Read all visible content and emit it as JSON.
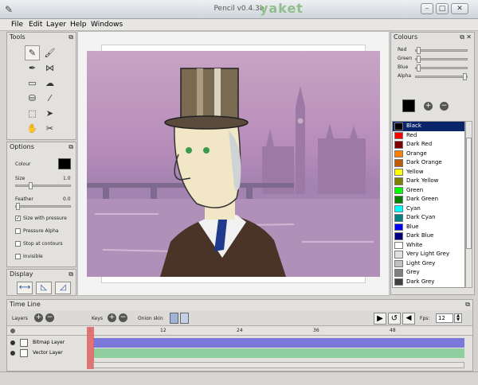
{
  "window": {
    "title": "Pencil v0.4.3b",
    "brand": "yaket",
    "controls": [
      "–",
      "□",
      "✕"
    ]
  },
  "menu": [
    "File",
    "Edit",
    "Layer",
    "Help",
    "Windows"
  ],
  "tools_panel": {
    "title": "Tools",
    "tools": [
      {
        "name": "pencil-icon",
        "glyph": "✎",
        "active": true
      },
      {
        "name": "brush-icon",
        "glyph": "🖌"
      },
      {
        "name": "pen-icon",
        "glyph": "✒"
      },
      {
        "name": "polyline-icon",
        "glyph": "⋈"
      },
      {
        "name": "eraser-icon",
        "glyph": "▭"
      },
      {
        "name": "smudge-icon",
        "glyph": "☁"
      },
      {
        "name": "bucket-icon",
        "glyph": "⛁"
      },
      {
        "name": "eyedropper-icon",
        "glyph": "⁄"
      },
      {
        "name": "select-icon",
        "glyph": "⬚"
      },
      {
        "name": "move-icon",
        "glyph": "➤"
      },
      {
        "name": "hand-icon",
        "glyph": "✋"
      },
      {
        "name": "clear-icon",
        "glyph": "✂"
      }
    ]
  },
  "options_panel": {
    "title": "Options",
    "colour_label": "Colour",
    "colour_value": "#000000",
    "size_label": "Size",
    "size_value": "1.0",
    "size_fraction": 0.25,
    "feather_label": "Feather",
    "feather_value": "0.0",
    "feather_fraction": 0.0,
    "checks": [
      {
        "label": "Size with pressure",
        "checked": true
      },
      {
        "label": "Pressure Alpha",
        "checked": false
      },
      {
        "label": "Stop at contours",
        "checked": false
      },
      {
        "label": "Invisible",
        "checked": false
      }
    ]
  },
  "display_panel": {
    "title": "Display",
    "buttons": [
      "flip-horizontal-icon",
      "thin-lines-icon",
      "outlines-icon"
    ]
  },
  "colours_panel": {
    "title": "Colours",
    "sliders": [
      {
        "label": "Red",
        "fraction": 0.02
      },
      {
        "label": "Green",
        "fraction": 0.02
      },
      {
        "label": "Blue",
        "fraction": 0.02
      },
      {
        "label": "Alpha",
        "fraction": 0.98
      }
    ],
    "current": "#000000",
    "add_symbol": "+",
    "remove_symbol": "−",
    "list": [
      {
        "name": "Black",
        "color": "#000000",
        "selected": true
      },
      {
        "name": "Red",
        "color": "#ff0000"
      },
      {
        "name": "Dark Red",
        "color": "#800000"
      },
      {
        "name": "Orange",
        "color": "#ff8000"
      },
      {
        "name": "Dark Orange",
        "color": "#c05a00"
      },
      {
        "name": "Yellow",
        "color": "#ffff00"
      },
      {
        "name": "Dark Yellow",
        "color": "#808000"
      },
      {
        "name": "Green",
        "color": "#00ff00"
      },
      {
        "name": "Dark Green",
        "color": "#008000"
      },
      {
        "name": "Cyan",
        "color": "#00ffff"
      },
      {
        "name": "Dark Cyan",
        "color": "#008080"
      },
      {
        "name": "Blue",
        "color": "#0000ff"
      },
      {
        "name": "Dark Blue",
        "color": "#000080"
      },
      {
        "name": "White",
        "color": "#ffffff"
      },
      {
        "name": "Very Light Grey",
        "color": "#e0e0e0"
      },
      {
        "name": "Light Grey",
        "color": "#c0c0c0"
      },
      {
        "name": "Grey",
        "color": "#808080"
      },
      {
        "name": "Dark Grey",
        "color": "#404040"
      }
    ]
  },
  "timeline": {
    "title": "Time Line",
    "layers_label": "Layers",
    "keys_label": "Keys",
    "onion_label": "Onion skin",
    "fps_label": "Fps:",
    "fps_value": "12",
    "ruler": [
      "1",
      "12",
      "24",
      "36",
      "48"
    ],
    "layers": [
      {
        "name": "Bitmap Layer",
        "icon": "bitmap-layer-icon",
        "color": "#7a78d8"
      },
      {
        "name": "Vector Layer",
        "icon": "vector-layer-icon",
        "color": "#8fcf9f"
      }
    ]
  },
  "theme": {
    "accent_selected": "#0a246a",
    "playhead": "#e06060"
  }
}
